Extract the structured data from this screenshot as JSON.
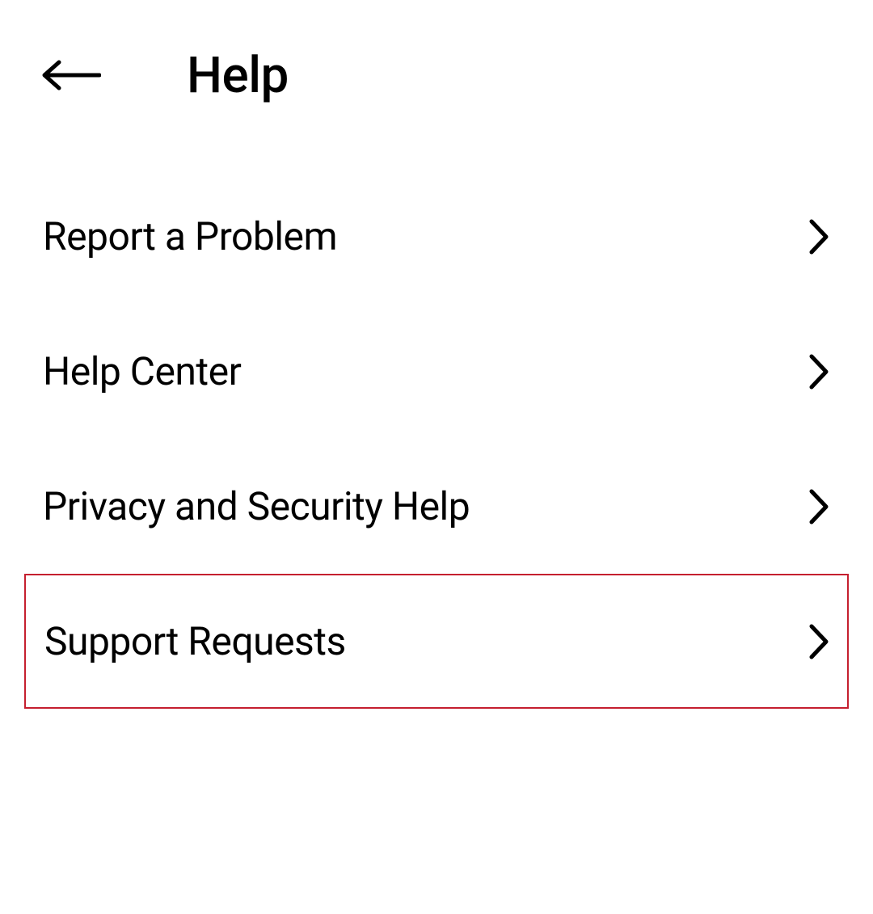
{
  "header": {
    "title": "Help"
  },
  "menu": {
    "items": [
      {
        "label": "Report a Problem",
        "highlighted": false
      },
      {
        "label": "Help Center",
        "highlighted": false
      },
      {
        "label": "Privacy and Security Help",
        "highlighted": false
      },
      {
        "label": "Support Requests",
        "highlighted": true
      }
    ]
  }
}
